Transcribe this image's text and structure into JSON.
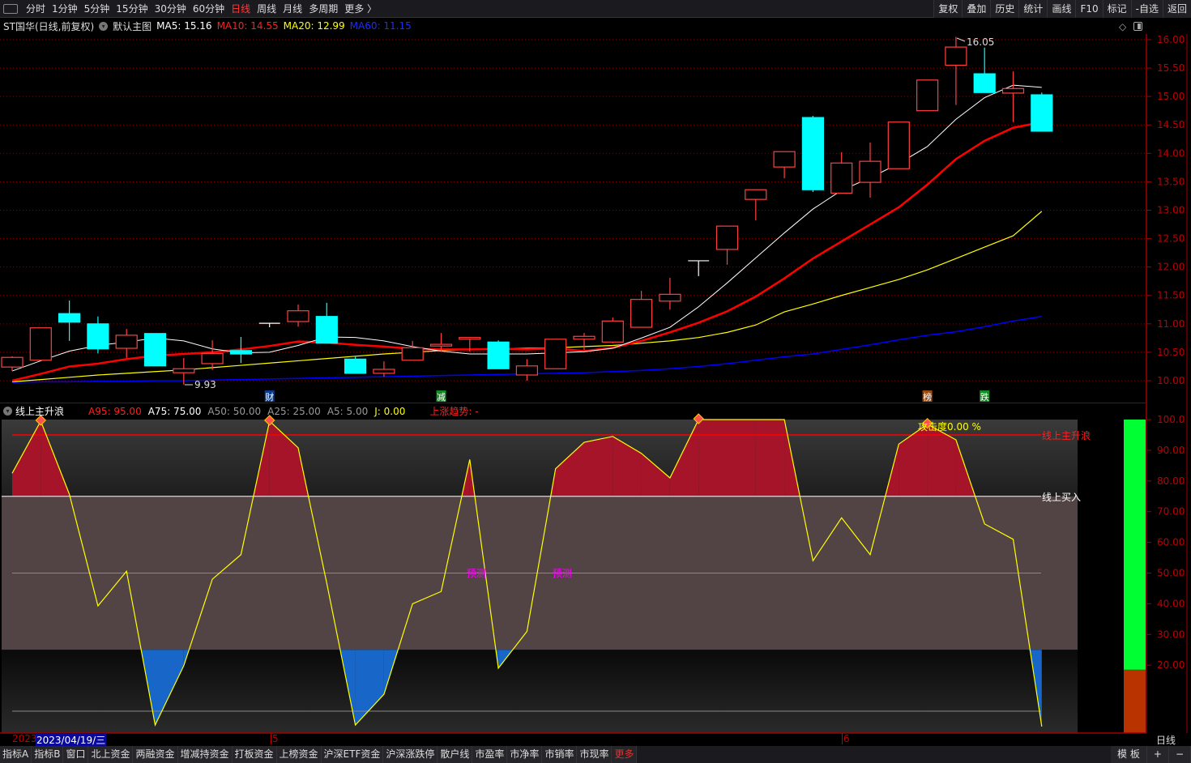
{
  "toolbar": {
    "periods": [
      "分时",
      "1分钟",
      "5分钟",
      "15分钟",
      "30分钟",
      "60分钟",
      "日线",
      "周线",
      "月线",
      "多周期",
      "更多 〉"
    ],
    "active_period": "日线",
    "right_buttons": [
      "复权",
      "叠加",
      "历史",
      "统计",
      "画线",
      "F10",
      "标记",
      "-自选",
      "返回"
    ]
  },
  "info": {
    "title": "ST国华(日线,前复权)",
    "chart_name": "默认主图",
    "ma5": "MA5: 15.16",
    "ma10": "MA10: 14.55",
    "ma20": "MA20: 12.99",
    "ma60": "MA60: 11.15"
  },
  "indicator": {
    "name": "线上主升浪",
    "a95": "A95: 95.00",
    "a75": "A75: 75.00",
    "a50": "A50: 50.00",
    "a25": "A25: 25.00",
    "a5": "A5: 5.00",
    "j": "J: 0.00",
    "trend": "上涨趋势: -",
    "label_main_wave": "线上主升浪",
    "label_buy": "线上买入",
    "attack": "攻击度0.00 %",
    "predict": "预测"
  },
  "colors": {
    "up": "#ff4040",
    "down": "#00ffff",
    "ma5": "#ffffff",
    "ma10": "#ff0000",
    "ma20": "#ffff00",
    "ma60": "#0000ff",
    "fill_red": "#a51428",
    "fill_blue": "#1866c8",
    "j_line": "#ffff00",
    "grid": "#8b0000",
    "green_bar": "#00ff33",
    "orange_bar": "#b83300"
  },
  "main_axis": {
    "labels": [
      "16.00",
      "15.50",
      "15.00",
      "14.50",
      "14.00",
      "13.50",
      "13.00",
      "12.50",
      "12.00",
      "11.50",
      "11.00",
      "10.50",
      "10.00"
    ]
  },
  "ind_axis": {
    "labels": [
      "100.0",
      "90.00",
      "80.00",
      "70.00",
      "60.00",
      "50.00",
      "40.00",
      "30.00",
      "20.00"
    ]
  },
  "annotations": {
    "high": "16.05",
    "low": "9.93"
  },
  "markers": [
    {
      "text": "财",
      "index": 9,
      "color": "#0a3a8a"
    },
    {
      "text": "减",
      "index": 15,
      "color": "#138a22"
    },
    {
      "text": "榜",
      "index": 32,
      "color": "#9a4a10"
    },
    {
      "text": "跌",
      "index": 34,
      "color": "#138a22"
    }
  ],
  "chart_data": {
    "type": "candlestick",
    "ylim": [
      9.8,
      16.3
    ],
    "candles": [
      [
        10.24,
        10.43,
        10.17,
        10.41
      ],
      [
        10.36,
        10.93,
        10.36,
        10.93
      ],
      [
        11.18,
        11.41,
        10.7,
        11.03
      ],
      [
        11.0,
        11.13,
        10.48,
        10.56
      ],
      [
        10.57,
        10.91,
        10.4,
        10.8
      ],
      [
        10.83,
        10.83,
        10.26,
        10.26
      ],
      [
        10.14,
        10.4,
        9.93,
        10.21
      ],
      [
        10.3,
        10.71,
        10.19,
        10.48
      ],
      [
        10.53,
        10.77,
        10.31,
        10.47
      ],
      [
        11.01,
        11.01,
        10.94,
        11.01
      ],
      [
        11.04,
        11.34,
        10.95,
        11.23
      ],
      [
        11.13,
        11.37,
        10.66,
        10.66
      ],
      [
        10.38,
        10.42,
        10.13,
        10.13
      ],
      [
        10.13,
        10.34,
        10.07,
        10.2
      ],
      [
        10.36,
        10.7,
        10.36,
        10.58
      ],
      [
        10.61,
        10.84,
        10.51,
        10.64
      ],
      [
        10.73,
        10.76,
        10.51,
        10.76
      ],
      [
        10.68,
        10.71,
        10.21,
        10.21
      ],
      [
        10.1,
        10.38,
        10.0,
        10.26
      ],
      [
        10.21,
        10.73,
        10.21,
        10.73
      ],
      [
        10.73,
        10.84,
        10.54,
        10.78
      ],
      [
        10.68,
        11.11,
        10.66,
        11.05
      ],
      [
        10.94,
        11.58,
        10.94,
        11.43
      ],
      [
        11.4,
        11.81,
        11.25,
        11.52
      ],
      [
        12.11,
        12.11,
        11.84,
        12.11
      ],
      [
        12.31,
        12.72,
        12.04,
        12.72
      ],
      [
        13.19,
        13.36,
        12.82,
        13.36
      ],
      [
        13.76,
        14.03,
        13.56,
        14.03
      ],
      [
        14.63,
        14.66,
        13.32,
        13.36
      ],
      [
        13.3,
        14.02,
        13.3,
        13.83
      ],
      [
        13.49,
        14.19,
        13.22,
        13.86
      ],
      [
        13.73,
        14.55,
        13.73,
        14.55
      ],
      [
        14.75,
        15.29,
        14.75,
        15.29
      ],
      [
        15.55,
        16.05,
        14.85,
        15.87
      ],
      [
        15.4,
        15.86,
        15.07,
        15.07
      ],
      [
        15.06,
        15.44,
        14.55,
        15.14
      ],
      [
        15.03,
        15.07,
        14.39,
        14.39
      ]
    ],
    "ma5": [
      10.17,
      10.35,
      10.52,
      10.62,
      10.68,
      10.75,
      10.7,
      10.56,
      10.49,
      10.5,
      10.62,
      10.77,
      10.76,
      10.7,
      10.6,
      10.52,
      10.47,
      10.47,
      10.47,
      10.49,
      10.51,
      10.57,
      10.75,
      10.94,
      11.3,
      11.72,
      12.16,
      12.6,
      13.02,
      13.35,
      13.57,
      13.82,
      14.12,
      14.6,
      14.98,
      15.2,
      15.16
    ],
    "ma10": [
      10.0,
      10.12,
      10.25,
      10.3,
      10.38,
      10.44,
      10.47,
      10.5,
      10.55,
      10.61,
      10.69,
      10.67,
      10.63,
      10.6,
      10.56,
      10.55,
      10.55,
      10.56,
      10.55,
      10.57,
      10.52,
      10.58,
      10.7,
      10.85,
      11.02,
      11.22,
      11.48,
      11.8,
      12.15,
      12.45,
      12.75,
      13.05,
      13.45,
      13.9,
      14.22,
      14.45,
      14.55
    ],
    "ma20": [
      9.98,
      10.02,
      10.06,
      10.1,
      10.13,
      10.16,
      10.19,
      10.23,
      10.27,
      10.31,
      10.35,
      10.39,
      10.43,
      10.47,
      10.5,
      10.53,
      10.55,
      10.56,
      10.57,
      10.58,
      10.6,
      10.62,
      10.66,
      10.7,
      10.76,
      10.85,
      10.98,
      11.21,
      11.35,
      11.5,
      11.64,
      11.78,
      11.95,
      12.15,
      12.35,
      12.55,
      12.98
    ],
    "ma60": [
      9.97,
      9.98,
      9.98,
      9.99,
      9.99,
      10.0,
      10.0,
      10.01,
      10.02,
      10.03,
      10.04,
      10.05,
      10.06,
      10.07,
      10.08,
      10.09,
      10.1,
      10.11,
      10.12,
      10.13,
      10.14,
      10.16,
      10.18,
      10.21,
      10.25,
      10.3,
      10.36,
      10.42,
      10.47,
      10.55,
      10.63,
      10.72,
      10.8,
      10.86,
      10.95,
      11.05,
      11.13
    ],
    "j": [
      82.5,
      99.5,
      75.7,
      39.3,
      50.6,
      0.5,
      19.8,
      48,
      56,
      99.5,
      90.8,
      46.7,
      0.5,
      10.5,
      40,
      44,
      87,
      19,
      31,
      84,
      92.6,
      94.5,
      89,
      81,
      100,
      100,
      100,
      100,
      54,
      68,
      56,
      92,
      98.5,
      93.4,
      66,
      61,
      0
    ],
    "j_peaks": [
      1,
      9,
      24,
      32
    ],
    "predict_at": [
      16,
      19
    ],
    "ind_ylim": [
      0,
      100
    ],
    "levels": [
      95,
      75,
      50,
      25,
      5
    ],
    "signal_bar_split": 18.5
  },
  "date_axis": {
    "year": "2023",
    "cursor_date": "2023/04/19/三",
    "month5": "5",
    "month6": "6",
    "period": "日线"
  },
  "bottombar": {
    "items": [
      "指标A",
      "指标B",
      "窗口",
      "北上资金",
      "两融资金",
      "增减持资金",
      "打板资金",
      "上榜资金",
      "沪深ETF资金",
      "沪深涨跌停",
      "散户线",
      "市盈率",
      "市净率",
      "市销率",
      "市现率",
      "更多"
    ],
    "right": [
      "模 板",
      "+",
      "−"
    ]
  }
}
